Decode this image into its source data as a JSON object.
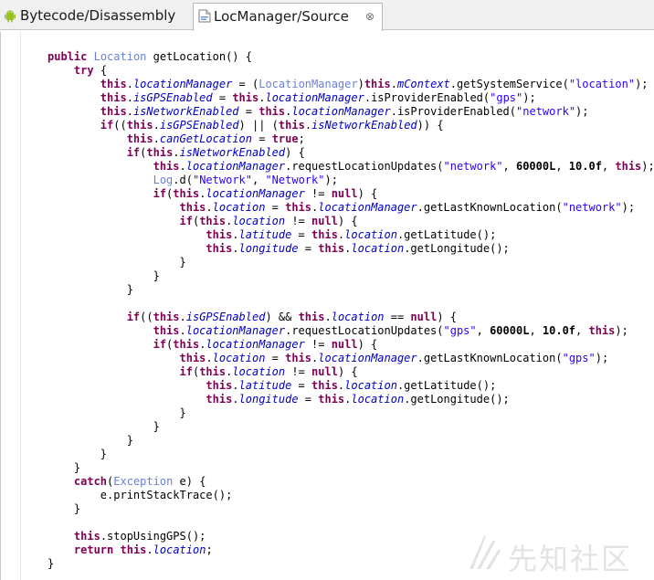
{
  "tabs": [
    {
      "label": "Bytecode/Disassembly",
      "icon": "android-icon",
      "active": false
    },
    {
      "label": "LocManager/Source",
      "icon": "java-source-icon",
      "active": true,
      "close_glyph": "⊗"
    }
  ],
  "editor": {
    "indent_unit": "    ",
    "lines": [
      {
        "indent": 0,
        "tokens": [
          [
            "keyword",
            "public"
          ],
          [
            "plain",
            " "
          ],
          [
            "type",
            "Location"
          ],
          [
            "plain",
            " getLocation() {"
          ]
        ]
      },
      {
        "indent": 1,
        "tokens": [
          [
            "keyword",
            "try"
          ],
          [
            "plain",
            " {"
          ]
        ]
      },
      {
        "indent": 2,
        "tokens": [
          [
            "keyword",
            "this"
          ],
          [
            "plain",
            "."
          ],
          [
            "field",
            "locationManager"
          ],
          [
            "plain",
            " = ("
          ],
          [
            "type",
            "LocationManager"
          ],
          [
            "plain",
            ")"
          ],
          [
            "keyword",
            "this"
          ],
          [
            "plain",
            "."
          ],
          [
            "field",
            "mContext"
          ],
          [
            "plain",
            ".getSystemService("
          ],
          [
            "string",
            "\"location\""
          ],
          [
            "plain",
            ");"
          ]
        ]
      },
      {
        "indent": 2,
        "tokens": [
          [
            "keyword",
            "this"
          ],
          [
            "plain",
            "."
          ],
          [
            "field",
            "isGPSEnabled"
          ],
          [
            "plain",
            " = "
          ],
          [
            "keyword",
            "this"
          ],
          [
            "plain",
            "."
          ],
          [
            "field",
            "locationManager"
          ],
          [
            "plain",
            ".isProviderEnabled("
          ],
          [
            "string",
            "\"gps\""
          ],
          [
            "plain",
            ");"
          ]
        ]
      },
      {
        "indent": 2,
        "tokens": [
          [
            "keyword",
            "this"
          ],
          [
            "plain",
            "."
          ],
          [
            "field",
            "isNetworkEnabled"
          ],
          [
            "plain",
            " = "
          ],
          [
            "keyword",
            "this"
          ],
          [
            "plain",
            "."
          ],
          [
            "field",
            "locationManager"
          ],
          [
            "plain",
            ".isProviderEnabled("
          ],
          [
            "string",
            "\"network\""
          ],
          [
            "plain",
            ");"
          ]
        ]
      },
      {
        "indent": 2,
        "tokens": [
          [
            "keyword",
            "if"
          ],
          [
            "plain",
            "(("
          ],
          [
            "keyword",
            "this"
          ],
          [
            "plain",
            "."
          ],
          [
            "field",
            "isGPSEnabled"
          ],
          [
            "plain",
            ") || ("
          ],
          [
            "keyword",
            "this"
          ],
          [
            "plain",
            "."
          ],
          [
            "field",
            "isNetworkEnabled"
          ],
          [
            "plain",
            ")) {"
          ]
        ]
      },
      {
        "indent": 3,
        "tokens": [
          [
            "keyword",
            "this"
          ],
          [
            "plain",
            "."
          ],
          [
            "field",
            "canGetLocation"
          ],
          [
            "plain",
            " = "
          ],
          [
            "keyword",
            "true"
          ],
          [
            "plain",
            ";"
          ]
        ]
      },
      {
        "indent": 3,
        "tokens": [
          [
            "keyword",
            "if"
          ],
          [
            "plain",
            "("
          ],
          [
            "keyword",
            "this"
          ],
          [
            "plain",
            "."
          ],
          [
            "field",
            "isNetworkEnabled"
          ],
          [
            "plain",
            ") {"
          ]
        ]
      },
      {
        "indent": 4,
        "tokens": [
          [
            "keyword",
            "this"
          ],
          [
            "plain",
            "."
          ],
          [
            "field",
            "locationManager"
          ],
          [
            "plain",
            ".requestLocationUpdates("
          ],
          [
            "string",
            "\"network\""
          ],
          [
            "plain",
            ", "
          ],
          [
            "number",
            "60000L"
          ],
          [
            "plain",
            ", "
          ],
          [
            "number",
            "10.0f"
          ],
          [
            "plain",
            ", "
          ],
          [
            "keyword",
            "this"
          ],
          [
            "plain",
            ");"
          ]
        ]
      },
      {
        "indent": 4,
        "tokens": [
          [
            "type",
            "Log"
          ],
          [
            "plain",
            ".d("
          ],
          [
            "string",
            "\"Network\""
          ],
          [
            "plain",
            ", "
          ],
          [
            "string",
            "\"Network\""
          ],
          [
            "plain",
            ");"
          ]
        ]
      },
      {
        "indent": 4,
        "tokens": [
          [
            "keyword",
            "if"
          ],
          [
            "plain",
            "("
          ],
          [
            "keyword",
            "this"
          ],
          [
            "plain",
            "."
          ],
          [
            "field",
            "locationManager"
          ],
          [
            "plain",
            " != "
          ],
          [
            "keyword",
            "null"
          ],
          [
            "plain",
            ") {"
          ]
        ]
      },
      {
        "indent": 5,
        "tokens": [
          [
            "keyword",
            "this"
          ],
          [
            "plain",
            "."
          ],
          [
            "field",
            "location"
          ],
          [
            "plain",
            " = "
          ],
          [
            "keyword",
            "this"
          ],
          [
            "plain",
            "."
          ],
          [
            "field",
            "locationManager"
          ],
          [
            "plain",
            ".getLastKnownLocation("
          ],
          [
            "string",
            "\"network\""
          ],
          [
            "plain",
            ");"
          ]
        ]
      },
      {
        "indent": 5,
        "tokens": [
          [
            "keyword",
            "if"
          ],
          [
            "plain",
            "("
          ],
          [
            "keyword",
            "this"
          ],
          [
            "plain",
            "."
          ],
          [
            "field",
            "location"
          ],
          [
            "plain",
            " != "
          ],
          [
            "keyword",
            "null"
          ],
          [
            "plain",
            ") {"
          ]
        ]
      },
      {
        "indent": 6,
        "tokens": [
          [
            "keyword",
            "this"
          ],
          [
            "plain",
            "."
          ],
          [
            "field",
            "latitude"
          ],
          [
            "plain",
            " = "
          ],
          [
            "keyword",
            "this"
          ],
          [
            "plain",
            "."
          ],
          [
            "field",
            "location"
          ],
          [
            "plain",
            ".getLatitude();"
          ]
        ]
      },
      {
        "indent": 6,
        "tokens": [
          [
            "keyword",
            "this"
          ],
          [
            "plain",
            "."
          ],
          [
            "field",
            "longitude"
          ],
          [
            "plain",
            " = "
          ],
          [
            "keyword",
            "this"
          ],
          [
            "plain",
            "."
          ],
          [
            "field",
            "location"
          ],
          [
            "plain",
            ".getLongitude();"
          ]
        ]
      },
      {
        "indent": 5,
        "tokens": [
          [
            "plain",
            "}"
          ]
        ]
      },
      {
        "indent": 4,
        "tokens": [
          [
            "plain",
            "}"
          ]
        ]
      },
      {
        "indent": 3,
        "tokens": [
          [
            "plain",
            "}"
          ]
        ]
      },
      {
        "indent": 0,
        "tokens": []
      },
      {
        "indent": 3,
        "tokens": [
          [
            "keyword",
            "if"
          ],
          [
            "plain",
            "(("
          ],
          [
            "keyword",
            "this"
          ],
          [
            "plain",
            "."
          ],
          [
            "field",
            "isGPSEnabled"
          ],
          [
            "plain",
            ") && "
          ],
          [
            "keyword",
            "this"
          ],
          [
            "plain",
            "."
          ],
          [
            "field",
            "location"
          ],
          [
            "plain",
            " == "
          ],
          [
            "keyword",
            "null"
          ],
          [
            "plain",
            ") {"
          ]
        ]
      },
      {
        "indent": 4,
        "tokens": [
          [
            "keyword",
            "this"
          ],
          [
            "plain",
            "."
          ],
          [
            "field",
            "locationManager"
          ],
          [
            "plain",
            ".requestLocationUpdates("
          ],
          [
            "string",
            "\"gps\""
          ],
          [
            "plain",
            ", "
          ],
          [
            "number",
            "60000L"
          ],
          [
            "plain",
            ", "
          ],
          [
            "number",
            "10.0f"
          ],
          [
            "plain",
            ", "
          ],
          [
            "keyword",
            "this"
          ],
          [
            "plain",
            ");"
          ]
        ]
      },
      {
        "indent": 4,
        "tokens": [
          [
            "keyword",
            "if"
          ],
          [
            "plain",
            "("
          ],
          [
            "keyword",
            "this"
          ],
          [
            "plain",
            "."
          ],
          [
            "field",
            "locationManager"
          ],
          [
            "plain",
            " != "
          ],
          [
            "keyword",
            "null"
          ],
          [
            "plain",
            ") {"
          ]
        ]
      },
      {
        "indent": 5,
        "tokens": [
          [
            "keyword",
            "this"
          ],
          [
            "plain",
            "."
          ],
          [
            "field",
            "location"
          ],
          [
            "plain",
            " = "
          ],
          [
            "keyword",
            "this"
          ],
          [
            "plain",
            "."
          ],
          [
            "field",
            "locationManager"
          ],
          [
            "plain",
            ".getLastKnownLocation("
          ],
          [
            "string",
            "\"gps\""
          ],
          [
            "plain",
            ");"
          ]
        ]
      },
      {
        "indent": 5,
        "tokens": [
          [
            "keyword",
            "if"
          ],
          [
            "plain",
            "("
          ],
          [
            "keyword",
            "this"
          ],
          [
            "plain",
            "."
          ],
          [
            "field",
            "location"
          ],
          [
            "plain",
            " != "
          ],
          [
            "keyword",
            "null"
          ],
          [
            "plain",
            ") {"
          ]
        ]
      },
      {
        "indent": 6,
        "tokens": [
          [
            "keyword",
            "this"
          ],
          [
            "plain",
            "."
          ],
          [
            "field",
            "latitude"
          ],
          [
            "plain",
            " = "
          ],
          [
            "keyword",
            "this"
          ],
          [
            "plain",
            "."
          ],
          [
            "field",
            "location"
          ],
          [
            "plain",
            ".getLatitude();"
          ]
        ]
      },
      {
        "indent": 6,
        "tokens": [
          [
            "keyword",
            "this"
          ],
          [
            "plain",
            "."
          ],
          [
            "field",
            "longitude"
          ],
          [
            "plain",
            " = "
          ],
          [
            "keyword",
            "this"
          ],
          [
            "plain",
            "."
          ],
          [
            "field",
            "location"
          ],
          [
            "plain",
            ".getLongitude();"
          ]
        ]
      },
      {
        "indent": 5,
        "tokens": [
          [
            "plain",
            "}"
          ]
        ]
      },
      {
        "indent": 4,
        "tokens": [
          [
            "plain",
            "}"
          ]
        ]
      },
      {
        "indent": 3,
        "tokens": [
          [
            "plain",
            "}"
          ]
        ]
      },
      {
        "indent": 2,
        "tokens": [
          [
            "plain",
            "}"
          ]
        ]
      },
      {
        "indent": 1,
        "tokens": [
          [
            "plain",
            "}"
          ]
        ]
      },
      {
        "indent": 1,
        "tokens": [
          [
            "keyword",
            "catch"
          ],
          [
            "plain",
            "("
          ],
          [
            "type",
            "Exception"
          ],
          [
            "plain",
            " e) {"
          ]
        ]
      },
      {
        "indent": 2,
        "tokens": [
          [
            "plain",
            "e.printStackTrace();"
          ]
        ]
      },
      {
        "indent": 1,
        "tokens": [
          [
            "plain",
            "}"
          ]
        ]
      },
      {
        "indent": 0,
        "tokens": []
      },
      {
        "indent": 1,
        "tokens": [
          [
            "keyword",
            "this"
          ],
          [
            "plain",
            ".stopUsingGPS();"
          ]
        ]
      },
      {
        "indent": 1,
        "tokens": [
          [
            "keyword",
            "return"
          ],
          [
            "plain",
            " "
          ],
          [
            "keyword",
            "this"
          ],
          [
            "plain",
            "."
          ],
          [
            "field",
            "location"
          ],
          [
            "plain",
            ";"
          ]
        ]
      },
      {
        "indent": 0,
        "tokens": [
          [
            "plain",
            "}"
          ]
        ]
      }
    ]
  },
  "watermark": {
    "text": "先知社区",
    "icon": "xianzhi-logo-icon"
  },
  "colors": {
    "keyword": "#7f0055",
    "type": "#6a7fd8",
    "field": "#0000c0",
    "string": "#2a00ff",
    "plain": "#000000"
  }
}
